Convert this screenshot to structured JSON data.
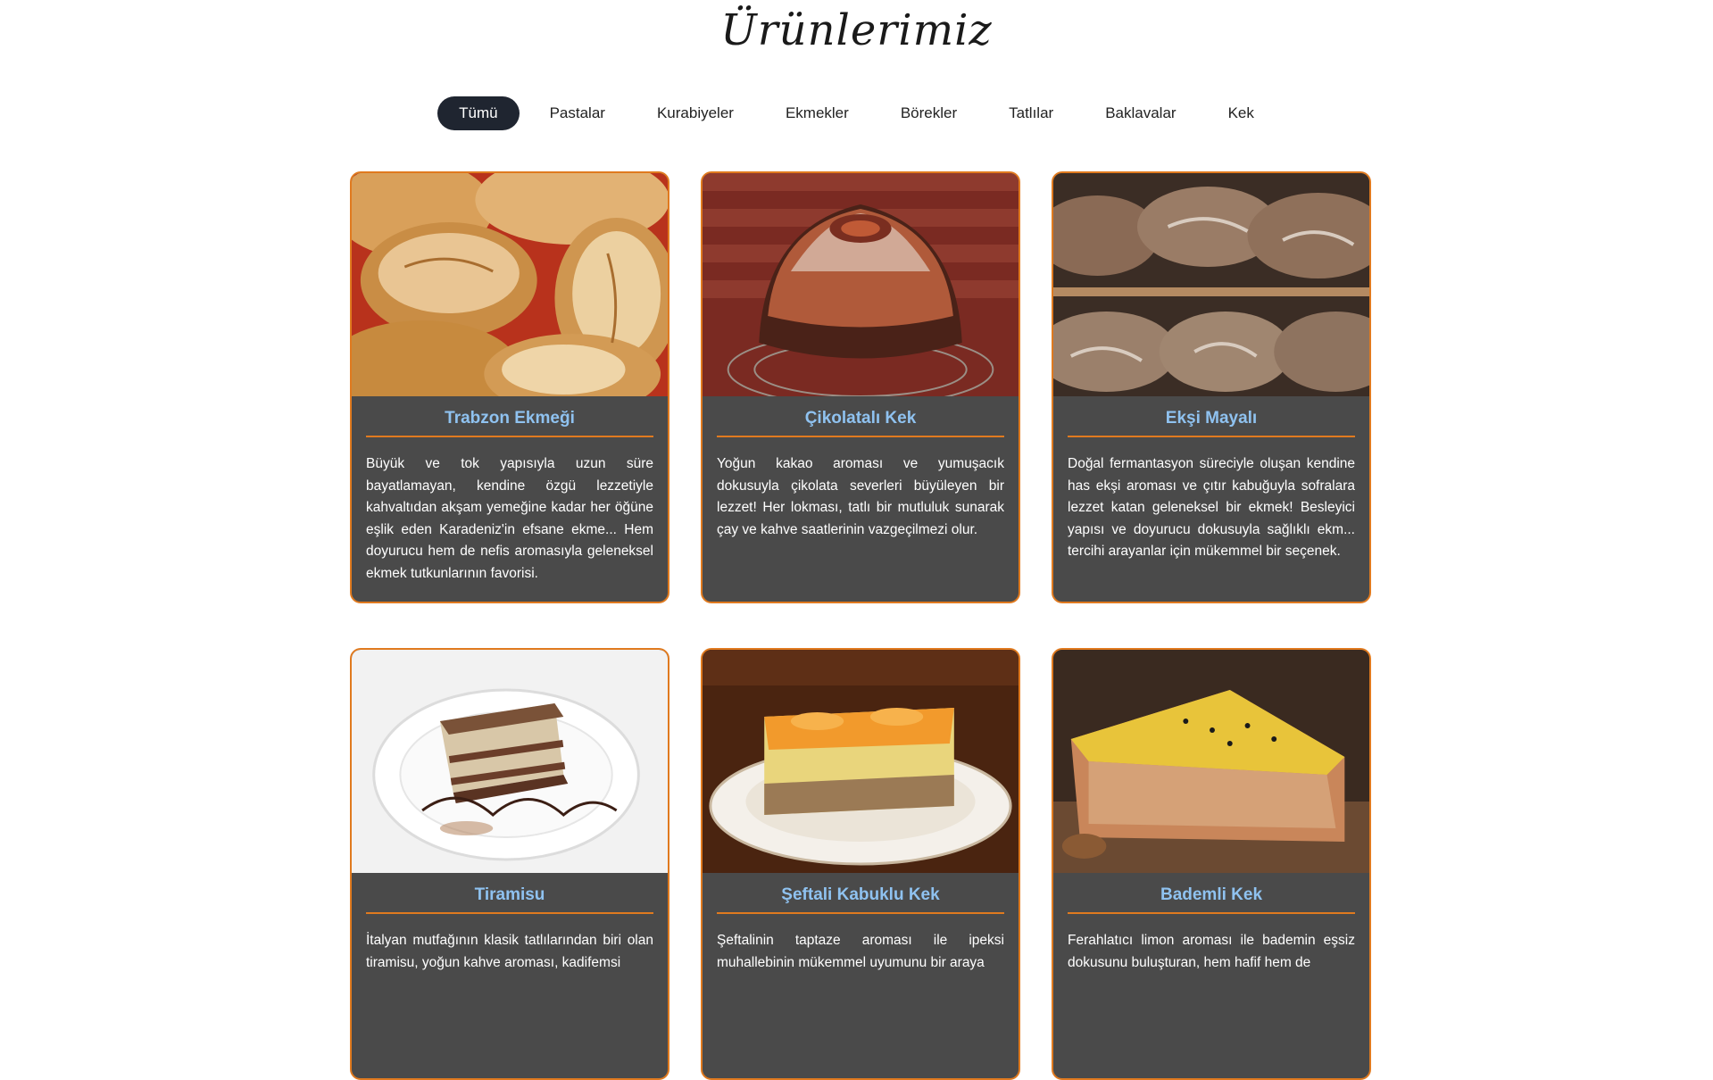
{
  "page": {
    "title": "Ürünlerimiz"
  },
  "filters": [
    {
      "label": "Tümü",
      "active": true
    },
    {
      "label": "Pastalar",
      "active": false
    },
    {
      "label": "Kurabiyeler",
      "active": false
    },
    {
      "label": "Ekmekler",
      "active": false
    },
    {
      "label": "Börekler",
      "active": false
    },
    {
      "label": "Tatlılar",
      "active": false
    },
    {
      "label": "Baklavalar",
      "active": false
    },
    {
      "label": "Kek",
      "active": false
    }
  ],
  "products": [
    {
      "title": "Trabzon Ekmeği",
      "image": "bread-rolls",
      "description": "Büyük ve tok yapısıyla uzun süre bayatlamayan, kendine özgü lezzetiyle kahvaltıdan akşam yemeğine kadar her öğüne eşlik eden Karadeniz'in efsane ekme... Hem doyurucu hem de nefis aromasıyla geleneksel ekmek tutkunlarının favorisi."
    },
    {
      "title": "Çikolatalı Kek",
      "image": "chocolate-bundt-cake",
      "description": "Yoğun kakao aroması ve yumuşacık dokusuyla çikolata severleri büyüleyen bir lezzet! Her lokması, tatlı bir mutluluk sunarak çay ve kahve saatlerinin vazgeçilmezi olur."
    },
    {
      "title": "Ekşi Mayalı",
      "image": "sourdough-loaves",
      "description": "Doğal fermantasyon süreciyle oluşan kendine has ekşi aroması ve çıtır kabuğuyla sofralara lezzet katan geleneksel bir ekmek! Besleyici yapısı ve doyurucu dokusuyla sağlıklı ekm... tercihi arayanlar için mükemmel bir seçenek."
    },
    {
      "title": "Tiramisu",
      "image": "tiramisu-slice",
      "description": "İtalyan mutfağının klasik tatlılarından biri olan tiramisu, yoğun kahve aroması, kadifemsi"
    },
    {
      "title": "Şeftali Kabuklu Kek",
      "image": "peach-cake",
      "description": "Şeftalinin taptaze aroması ile ipeksi muhallebinin mükemmel uyumunu bir araya"
    },
    {
      "title": "Bademli Kek",
      "image": "almond-cake",
      "description": "Ferahlatıcı limon aroması ile bademin eşsiz dokusunu buluşturan, hem hafif hem de"
    }
  ]
}
